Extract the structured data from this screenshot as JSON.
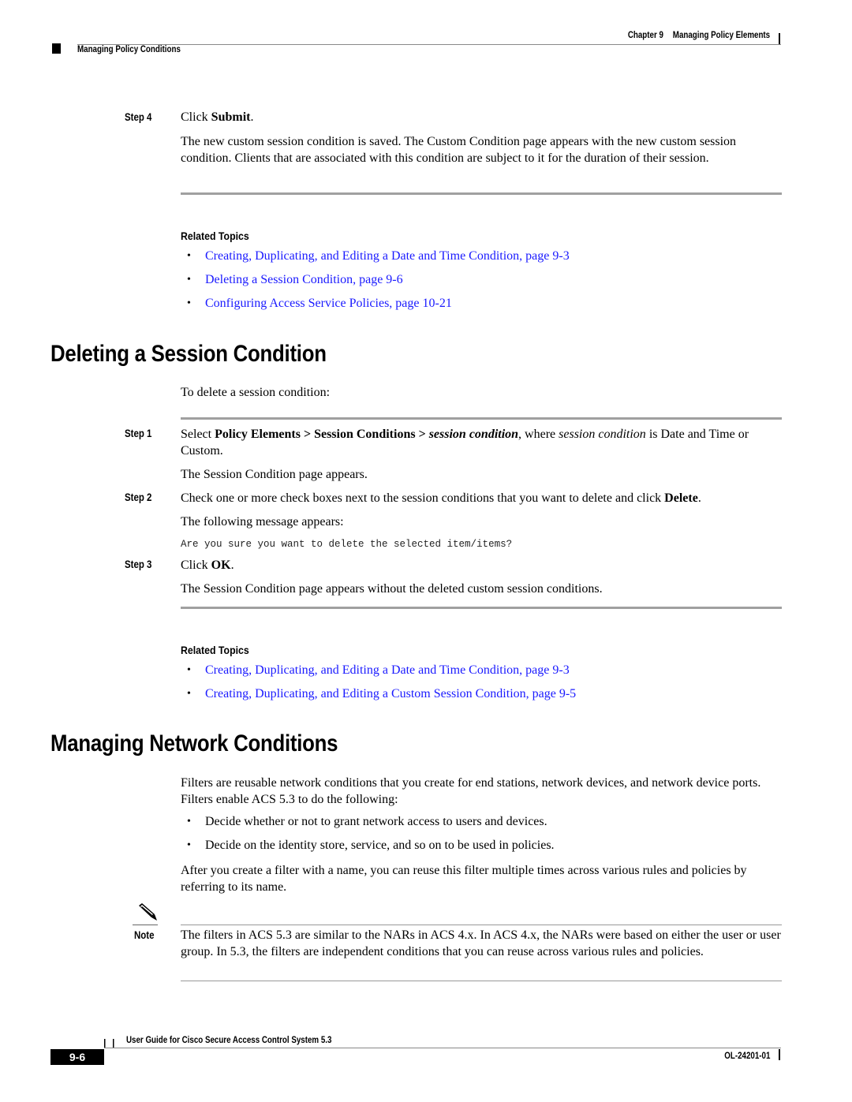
{
  "header": {
    "chapter_label": "Chapter 9",
    "chapter_title": "Managing Policy Elements",
    "section_title": "Managing Policy Conditions"
  },
  "top_procedure": {
    "step4": {
      "label": "Step 4",
      "text_prefix": "Click ",
      "text_bold": "Submit",
      "text_suffix": ".",
      "description": "The new custom session condition is saved. The Custom Condition page appears with the new custom session condition. Clients that are associated with this condition are subject to it for the duration of their session."
    },
    "related_topics_title": "Related Topics",
    "related_topics": [
      "Creating, Duplicating, and Editing a Date and Time Condition, page 9-3",
      "Deleting a Session Condition, page 9-6",
      "Configuring Access Service Policies, page 10-21"
    ]
  },
  "deleting_section": {
    "heading": "Deleting a Session Condition",
    "intro": "To delete a session condition:",
    "step1": {
      "label": "Step 1",
      "t1": "Select ",
      "b1": "Policy Elements > Session Conditions > ",
      "bi1": "session condition",
      "t2": ", where ",
      "i1": "session condition",
      "t3": " is Date and Time or Custom.",
      "result": "The Session Condition page appears."
    },
    "step2": {
      "label": "Step 2",
      "text": "Check one or more check boxes next to the session conditions that you want to delete and click ",
      "bold": "Delete",
      "suffix": ".",
      "result": "The following message appears:",
      "message": "Are you sure you want to delete the selected item/items?"
    },
    "step3": {
      "label": "Step 3",
      "text_prefix": "Click ",
      "text_bold": "OK",
      "text_suffix": ".",
      "result": "The Session Condition page appears without the deleted custom session conditions."
    },
    "related_topics_title": "Related Topics",
    "related_topics": [
      "Creating, Duplicating, and Editing a Date and Time Condition, page 9-3",
      "Creating, Duplicating, and Editing a Custom Session Condition, page 9-5"
    ]
  },
  "network_section": {
    "heading": "Managing Network Conditions",
    "intro": "Filters are reusable network conditions that you create for end stations, network devices, and network device ports. Filters enable ACS 5.3 to do the following:",
    "bullets": [
      "Decide whether or not to grant network access to users and devices.",
      "Decide on the identity store, service, and so on to be used in policies."
    ],
    "after": "After you create a filter with a name, you can reuse this filter multiple times across various rules and policies by referring to its name.",
    "note_label": "Note",
    "note_text": "The filters in ACS 5.3 are similar to the NARs in ACS 4.x. In ACS 4.x, the NARs were based on either the user or user group. In 5.3, the filters are independent conditions that you can reuse across various rules and policies."
  },
  "footer": {
    "guide_title": "User Guide for Cisco Secure Access Control System 5.3",
    "page_number": "9-6",
    "doc_number": "OL-24201-01"
  },
  "colors": {
    "link": "#1a1aff",
    "rule": "#a0a0a0"
  }
}
